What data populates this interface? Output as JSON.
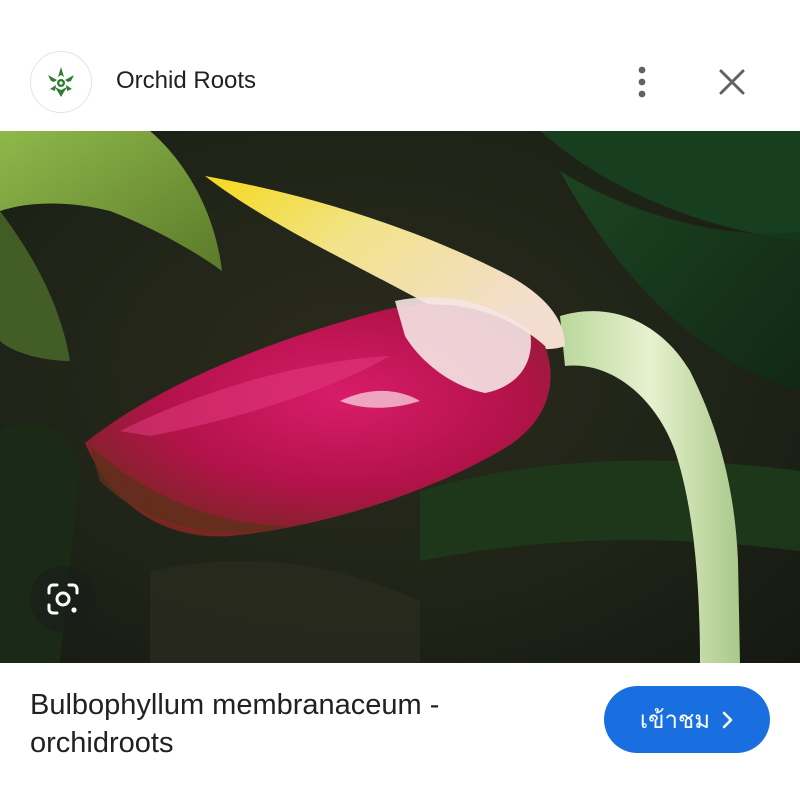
{
  "header": {
    "site_name": "Orchid Roots",
    "logo_icon": "orchid-roots-logo",
    "menu_icon": "more-vert-icon",
    "close_icon": "close-icon"
  },
  "image": {
    "subject": "orchid-flower-photo",
    "lens_icon": "google-lens-icon"
  },
  "result": {
    "title": "Bulbophyllum membranaceum - orchidroots",
    "visit_label": "เข้าชม",
    "visit_icon": "chevron-right-icon"
  },
  "colors": {
    "accent": "#1a6fe0",
    "logo_green": "#2e7d32",
    "flower_magenta": "#b3124a",
    "petal_yellow": "#f2d21a"
  }
}
